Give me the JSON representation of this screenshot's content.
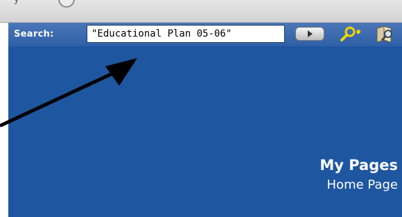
{
  "top_strip": {
    "partial_text": "y"
  },
  "search_bar": {
    "label": "Search:",
    "input_value": "\"Educational Plan 05-06\"",
    "go_button_icon": "play-arrow-icon",
    "advanced_search_icon": "magnifier-plus-icon",
    "help_icon": "book-magnifier-icon"
  },
  "main": {
    "title": "My Pages",
    "link": "Home Page"
  },
  "colors": {
    "search_bar": "#3567ae",
    "main_background": "#1e56a0",
    "text": "#ffffff",
    "annotation_arrow": "#000000"
  }
}
